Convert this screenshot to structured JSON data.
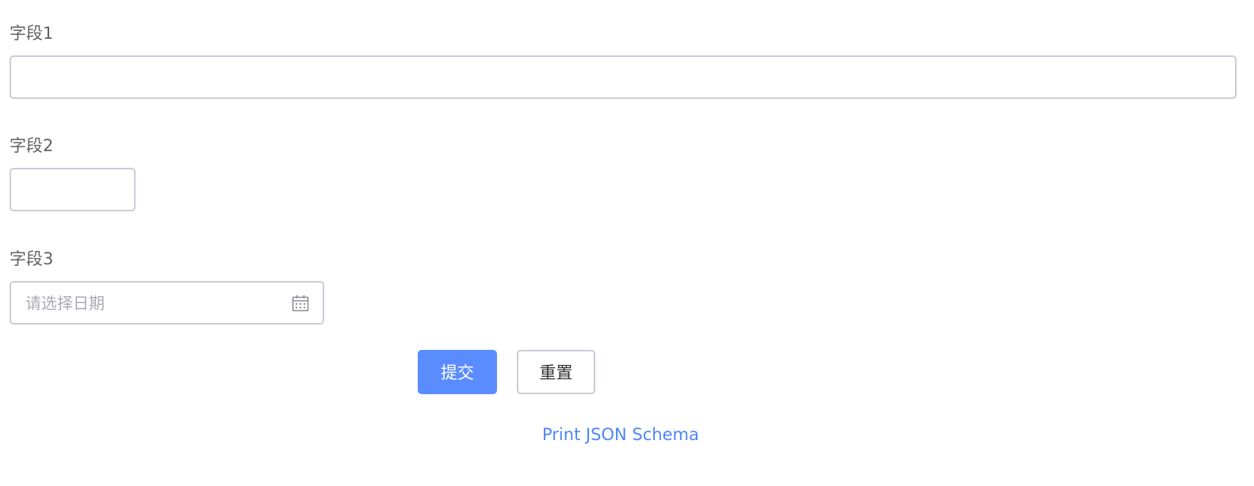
{
  "form": {
    "fields": [
      {
        "label": "字段1",
        "value": "",
        "placeholder": ""
      },
      {
        "label": "字段2",
        "value": "",
        "placeholder": ""
      },
      {
        "label": "字段3",
        "value": "",
        "placeholder": "请选择日期",
        "icon": "calendar-icon"
      }
    ],
    "submit_label": "提交",
    "reset_label": "重置",
    "print_link": "Print JSON Schema"
  },
  "colors": {
    "primary": "#5b8cff",
    "border": "#c9cdd6",
    "label": "#606266",
    "link": "#4f86f7"
  }
}
